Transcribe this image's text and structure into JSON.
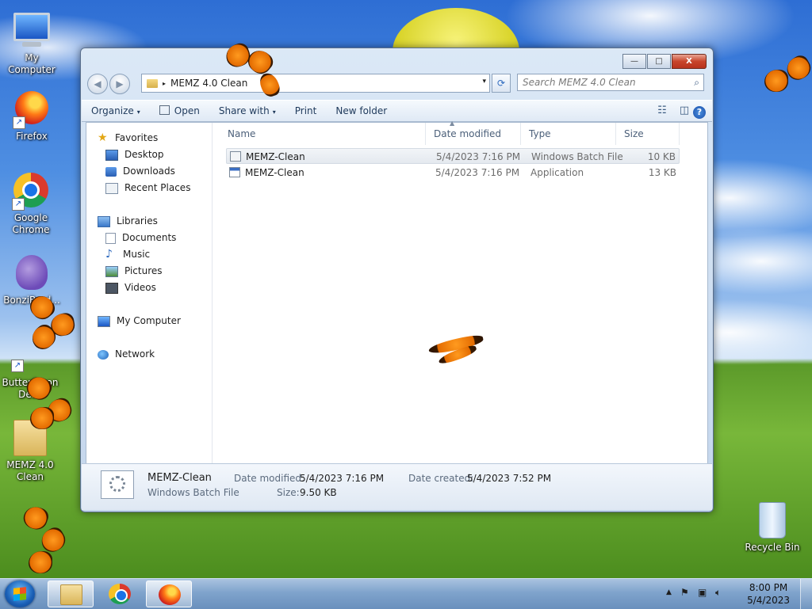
{
  "desktop": {
    "icons": [
      {
        "label": "My Computer"
      },
      {
        "label": "Firefox"
      },
      {
        "label": "Google Chrome"
      },
      {
        "label": "BonziB...d..."
      },
      {
        "label": "Butterfly on Desk"
      },
      {
        "label": "MEMZ 4.0 Clean"
      },
      {
        "label": "Recycle Bin"
      }
    ]
  },
  "window": {
    "caption": {
      "minimize": "—",
      "maximize": "□",
      "close": "X"
    },
    "address": {
      "arrow": "▸",
      "path": "MEMZ 4.0 Clean",
      "dropdown": "▾",
      "refresh": "⟳"
    },
    "search": {
      "placeholder": "Search MEMZ 4.0 Clean"
    },
    "toolbar": {
      "organize": "Organize",
      "open": "Open",
      "share_with": "Share with",
      "print": "Print",
      "new_folder": "New folder",
      "caret": "▾"
    },
    "nav": {
      "favorites": "Favorites",
      "desktop": "Desktop",
      "downloads": "Downloads",
      "recent_places": "Recent Places",
      "libraries": "Libraries",
      "documents": "Documents",
      "music": "Music",
      "pictures": "Pictures",
      "videos": "Videos",
      "my_computer": "My Computer",
      "network": "Network"
    },
    "columns": {
      "name": "Name",
      "date_modified": "Date modified",
      "type": "Type",
      "size": "Size"
    },
    "files": [
      {
        "name": "MEMZ-Clean",
        "date": "5/4/2023 7:16 PM",
        "type": "Windows Batch File",
        "size": "10 KB"
      },
      {
        "name": "MEMZ-Clean",
        "date": "5/4/2023 7:16 PM",
        "type": "Application",
        "size": "13 KB"
      }
    ],
    "details": {
      "name": "MEMZ-Clean",
      "type": "Windows Batch File",
      "date_modified_label": "Date modified:",
      "date_modified": "5/4/2023 7:16 PM",
      "date_created_label": "Date created:",
      "date_created": "5/4/2023 7:52 PM",
      "size_label": "Size:",
      "size": "9.50 KB"
    }
  },
  "taskbar": {
    "tray_up": "▲",
    "time": "8:00 PM",
    "date": "5/4/2023"
  }
}
